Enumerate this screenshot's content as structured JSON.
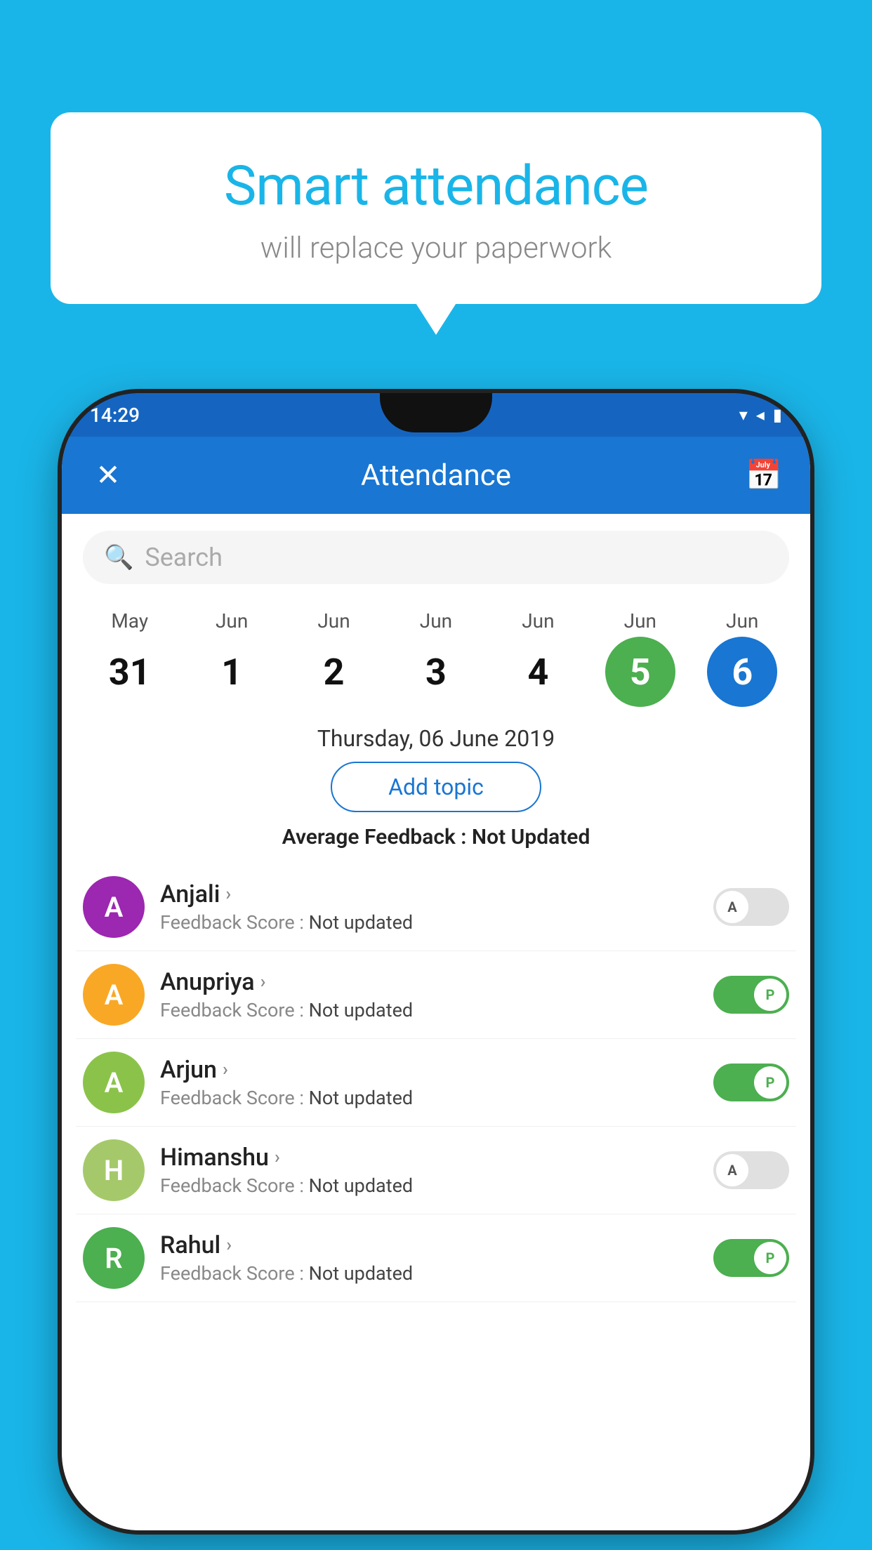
{
  "background_color": "#1ab5e8",
  "bubble": {
    "title": "Smart attendance",
    "subtitle": "will replace your paperwork"
  },
  "status_bar": {
    "time": "14:29",
    "icons": "▼◀▮"
  },
  "app_bar": {
    "title": "Attendance",
    "close_label": "✕",
    "calendar_label": "📅"
  },
  "search": {
    "placeholder": "Search"
  },
  "calendar": {
    "days": [
      {
        "month": "May",
        "date": "31",
        "style": "normal"
      },
      {
        "month": "Jun",
        "date": "1",
        "style": "normal"
      },
      {
        "month": "Jun",
        "date": "2",
        "style": "normal"
      },
      {
        "month": "Jun",
        "date": "3",
        "style": "normal"
      },
      {
        "month": "Jun",
        "date": "4",
        "style": "normal"
      },
      {
        "month": "Jun",
        "date": "5",
        "style": "selected-green"
      },
      {
        "month": "Jun",
        "date": "6",
        "style": "selected-blue"
      }
    ]
  },
  "selected_date": "Thursday, 06 June 2019",
  "add_topic_label": "Add topic",
  "avg_feedback_label": "Average Feedback :",
  "avg_feedback_value": "Not Updated",
  "students": [
    {
      "name": "Anjali",
      "initial": "A",
      "avatar_color": "#9c27b0",
      "feedback_label": "Feedback Score :",
      "feedback_value": "Not updated",
      "toggle": "off",
      "toggle_label": "A"
    },
    {
      "name": "Anupriya",
      "initial": "A",
      "avatar_color": "#f9a825",
      "feedback_label": "Feedback Score :",
      "feedback_value": "Not updated",
      "toggle": "on",
      "toggle_label": "P"
    },
    {
      "name": "Arjun",
      "initial": "A",
      "avatar_color": "#8bc34a",
      "feedback_label": "Feedback Score :",
      "feedback_value": "Not updated",
      "toggle": "on",
      "toggle_label": "P"
    },
    {
      "name": "Himanshu",
      "initial": "H",
      "avatar_color": "#a5c96a",
      "feedback_label": "Feedback Score :",
      "feedback_value": "Not updated",
      "toggle": "off",
      "toggle_label": "A"
    },
    {
      "name": "Rahul",
      "initial": "R",
      "avatar_color": "#4caf50",
      "feedback_label": "Feedback Score :",
      "feedback_value": "Not updated",
      "toggle": "on",
      "toggle_label": "P"
    }
  ]
}
